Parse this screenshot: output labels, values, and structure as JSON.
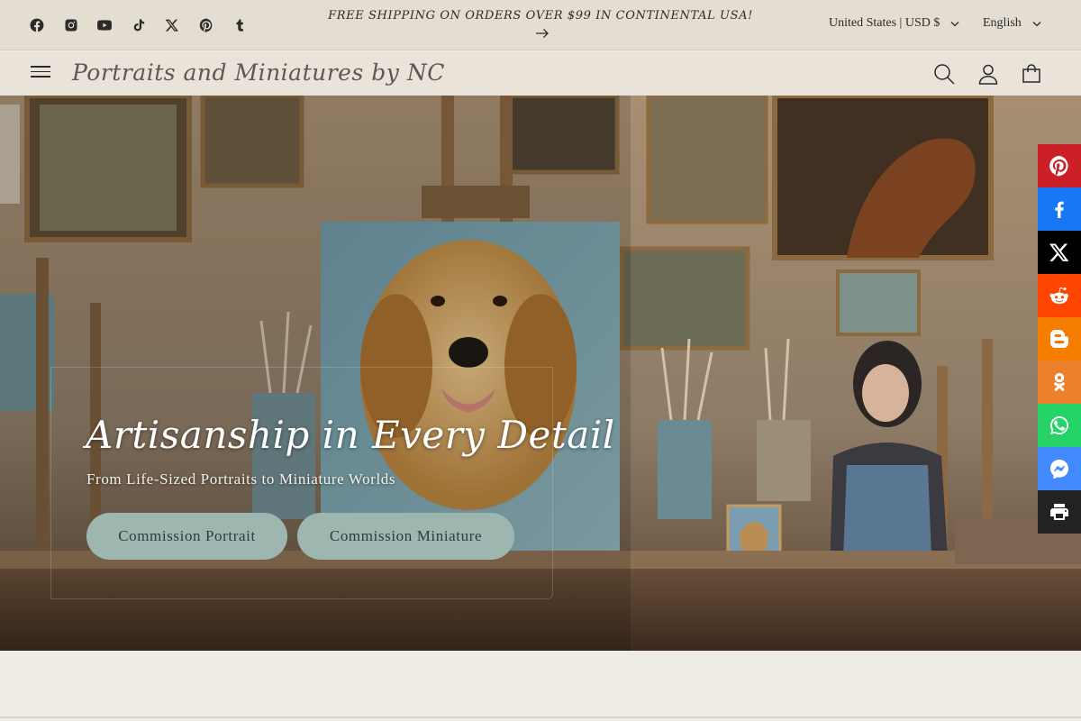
{
  "announcement": {
    "social_icons": [
      "facebook-icon",
      "instagram-icon",
      "youtube-icon",
      "tiktok-icon",
      "x-icon",
      "pinterest-icon",
      "tumblr-icon"
    ],
    "promo_text": "FREE SHIPPING ON ORDERS OVER $99 IN CONTINENTAL USA!",
    "country_currency": "United States | USD $",
    "language": "English"
  },
  "header": {
    "brand": "Portraits and Miniatures by NC",
    "icons": [
      "menu-icon",
      "search-icon",
      "account-icon",
      "cart-icon"
    ]
  },
  "hero": {
    "title": "Artisanship in Every Detail",
    "subtitle": "From Life-Sized Portraits to Miniature Worlds",
    "buttons": {
      "portrait": "Commission Portrait",
      "miniature": "Commission Miniature"
    }
  },
  "share_bar": [
    {
      "name": "pinterest",
      "color": "#cb2027"
    },
    {
      "name": "facebook",
      "color": "#1877f2"
    },
    {
      "name": "x",
      "color": "#000000"
    },
    {
      "name": "reddit",
      "color": "#ff4500"
    },
    {
      "name": "blogger",
      "color": "#f57d00"
    },
    {
      "name": "odnoklassniki",
      "color": "#ed812b"
    },
    {
      "name": "whatsapp",
      "color": "#25d366"
    },
    {
      "name": "messenger",
      "color": "#448aff"
    },
    {
      "name": "print",
      "color": "#222222"
    }
  ],
  "colors": {
    "announcement_bg": "#e4ddd2",
    "header_bg": "#e9e3da",
    "button_bg": "#9db6b0",
    "page_bg": "#efebe5"
  }
}
